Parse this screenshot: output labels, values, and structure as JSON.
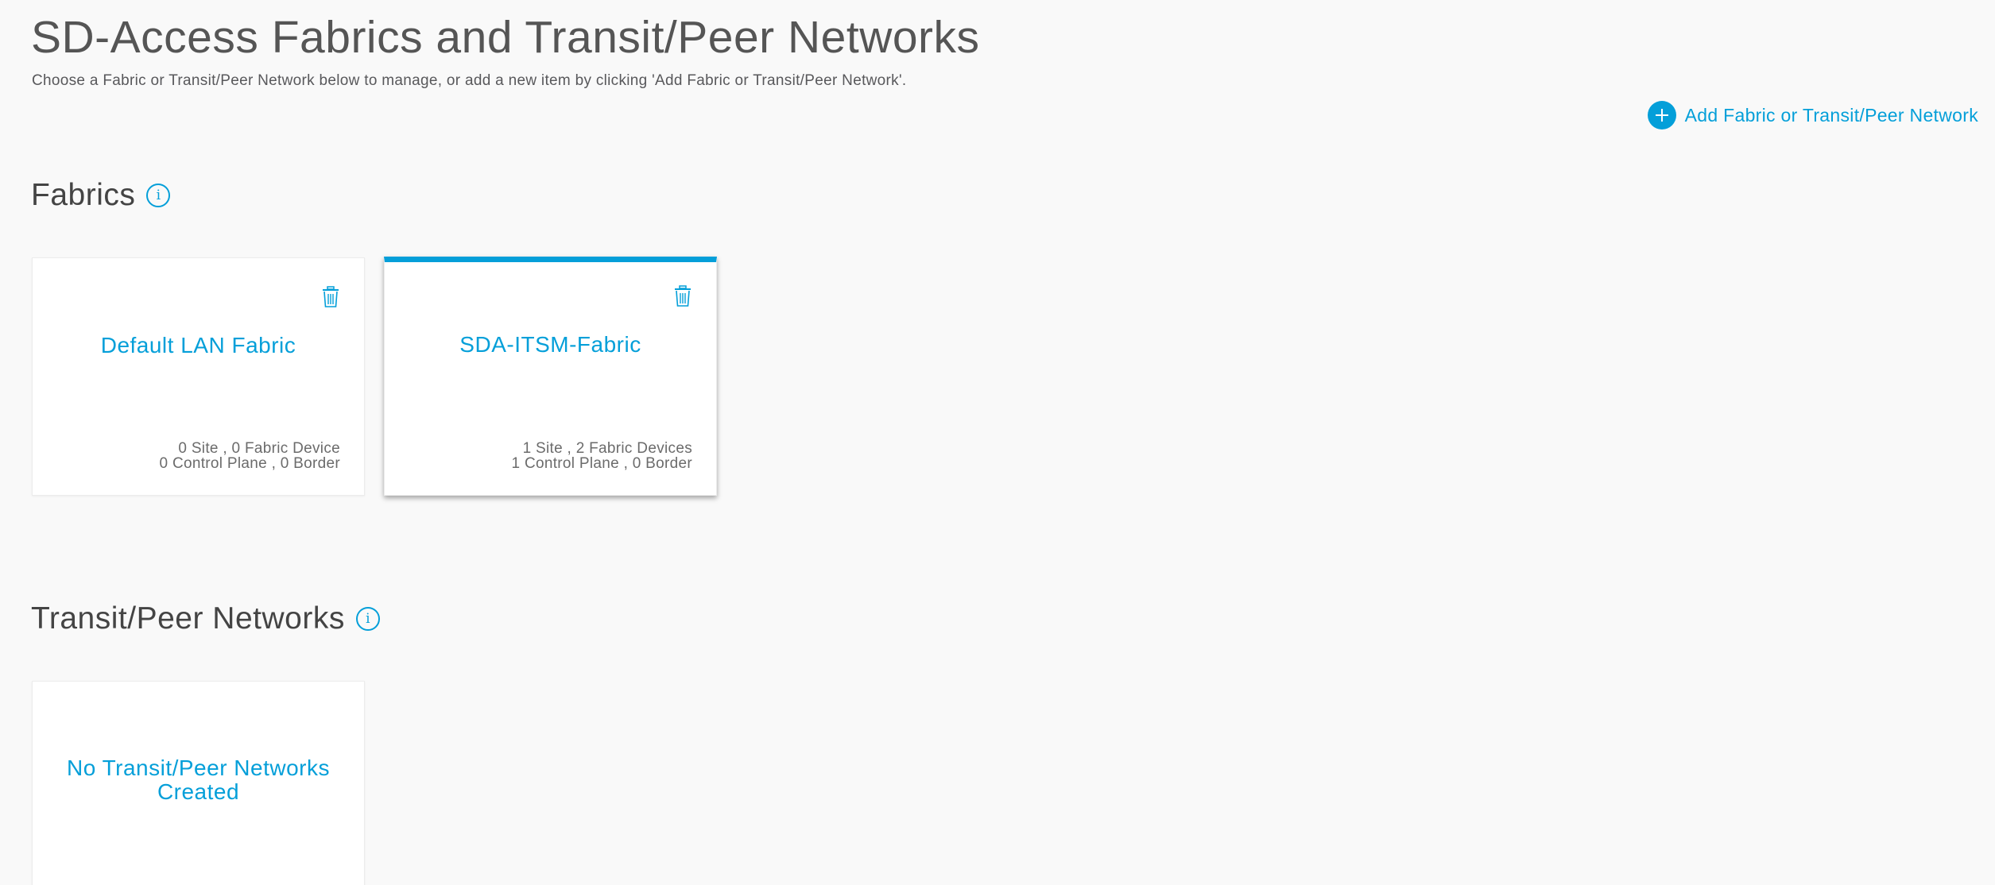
{
  "header": {
    "title": "SD-Access Fabrics and Transit/Peer Networks",
    "subtitle": "Choose a Fabric or Transit/Peer Network below to manage, or add a new item by clicking 'Add Fabric or Transit/Peer Network'."
  },
  "actions": {
    "add_label": "Add Fabric or Transit/Peer Network",
    "add_icon": "plus-circle-icon"
  },
  "colors": {
    "accent": "#049fd9",
    "background": "#f9f9f9",
    "card": "#ffffff"
  },
  "fabrics": {
    "title": "Fabrics",
    "info_icon": "info-icon",
    "items": [
      {
        "name": "Default LAN Fabric",
        "stats_line1": "0 Site , 0 Fabric Device",
        "stats_line2": "0 Control Plane , 0 Border",
        "selected": false
      },
      {
        "name": "SDA-ITSM-Fabric",
        "stats_line1": "1 Site , 2 Fabric Devices",
        "stats_line2": "1 Control Plane , 0 Border",
        "selected": true
      }
    ]
  },
  "transit": {
    "title": "Transit/Peer Networks",
    "info_icon": "info-icon",
    "empty_text": "No Transit/Peer Networks Created"
  }
}
